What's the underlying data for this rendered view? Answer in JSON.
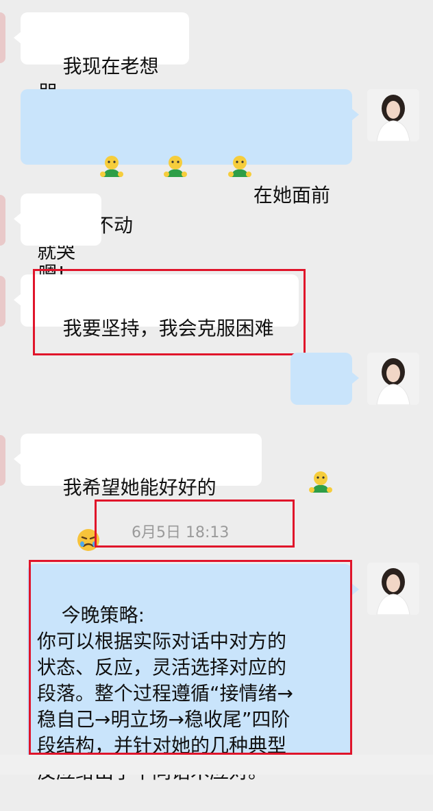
{
  "colors": {
    "background": "#ededed",
    "incoming_bubble": "#ffffff",
    "outgoing_bubble": "#c9e4fb",
    "highlight_box": "#e0142a",
    "timestamp_text": "#9a9a9a"
  },
  "messages": [
    {
      "direction": "incoming",
      "text": "我现在老想哭"
    },
    {
      "direction": "outgoing",
      "emoji": [
        "man-shrug-icon",
        "man-shrug-icon",
        "man-shrug-icon"
      ],
      "text": "在她面前不能动不动\n就哭"
    },
    {
      "direction": "incoming",
      "text": "嗯!"
    },
    {
      "direction": "incoming",
      "text": "我要坚持，我会克服困难"
    },
    {
      "direction": "outgoing",
      "emoji": [
        "man-shrug-icon"
      ],
      "text": ""
    },
    {
      "direction": "incoming",
      "text": "我希望她能好好的",
      "emoji_after": "sad-face-icon"
    },
    {
      "direction": "outgoing",
      "text": "今晚策略:\n你可以根据实际对话中对方的\n状态、反应，灵活选择对应的\n段落。整个过程遵循“接情绪→\n稳自己→明立场→稳收尾”四阶\n段结构，并针对她的几种典型\n反应给出了不同话术应对。"
    }
  ],
  "timestamp": "6月5日  18:13"
}
